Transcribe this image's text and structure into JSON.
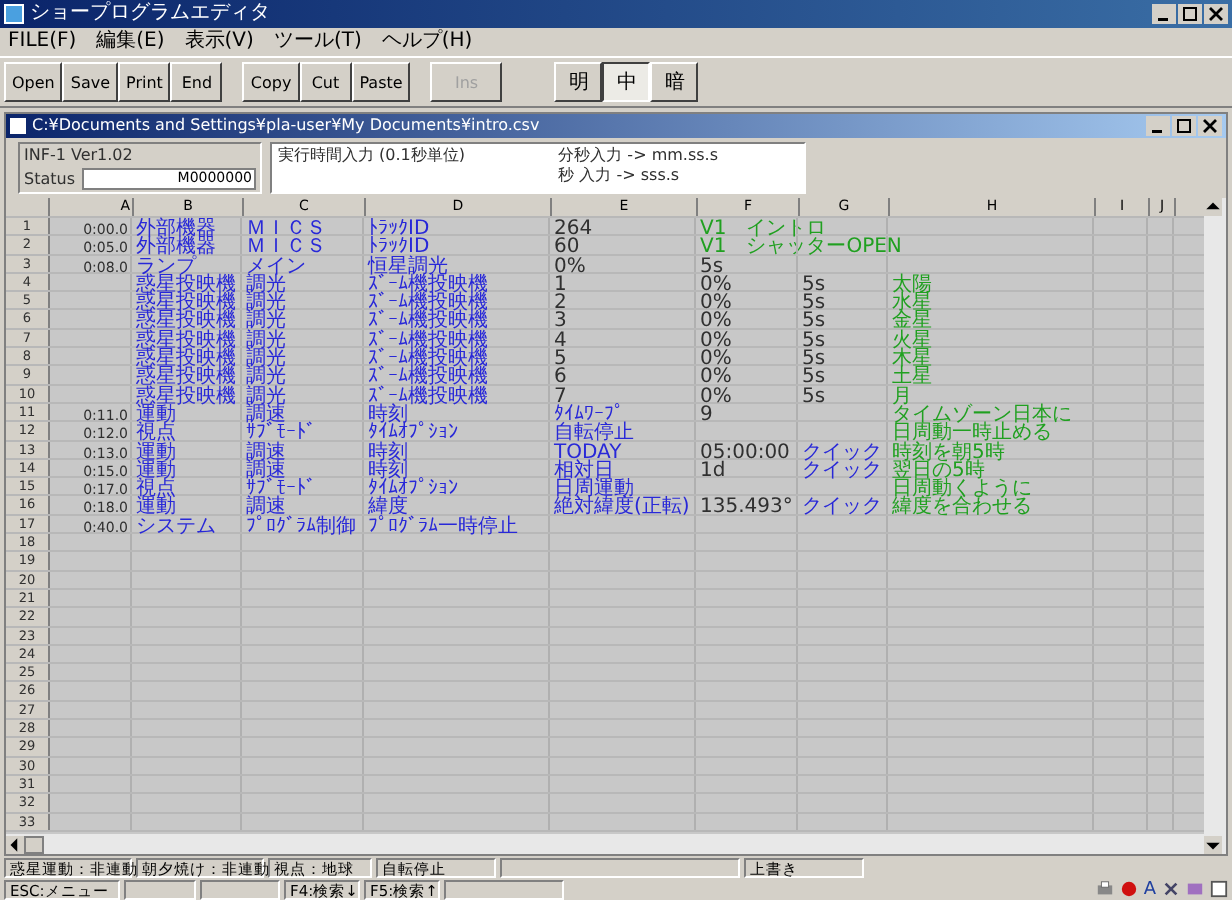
{
  "window": {
    "title": "ショープログラムエディタ"
  },
  "menu": [
    "FILE(F)",
    "編集(E)",
    "表示(V)",
    "ツール(T)",
    "ヘルプ(H)"
  ],
  "toolbar": {
    "groups": [
      [
        {
          "label": "Open",
          "disabled": false
        },
        {
          "label": "Save",
          "disabled": false
        },
        {
          "label": "Print",
          "disabled": false
        },
        {
          "label": "End",
          "disabled": false
        }
      ],
      [
        {
          "label": "Copy",
          "disabled": false
        },
        {
          "label": "Cut",
          "disabled": false
        },
        {
          "label": "Paste",
          "disabled": false
        }
      ],
      [
        {
          "label": "Ins",
          "disabled": true
        }
      ]
    ],
    "modes": [
      {
        "label": "明",
        "selected": false
      },
      {
        "label": "中",
        "selected": true
      },
      {
        "label": "暗",
        "selected": false
      }
    ]
  },
  "document": {
    "title": "C:¥Documents and Settings¥pla-user¥My Documents¥intro.csv"
  },
  "header": {
    "version": "INF-1  Ver1.02",
    "status_label": "Status",
    "status_value": "M0000000",
    "time_label": "実行時間入力 (0.1秒単位)",
    "hint_1": "分秒入力 -> mm.ss.s",
    "hint_2": "秒 入力 -> sss.s"
  },
  "table": {
    "columns": [
      "A",
      "B",
      "C",
      "D",
      "E",
      "F",
      "G",
      "H",
      "I",
      "J"
    ],
    "rows": [
      {
        "number": "1",
        "a": {
          "text": "0:00.0",
          "color": "#303030"
        },
        "b": {
          "text": "外部機器",
          "color": "#2828d8"
        },
        "c": {
          "text": "ＭＩＣＳ",
          "color": "#2828d8"
        },
        "d": {
          "text": "ﾄﾗｯｸID",
          "color": "#2828d8"
        },
        "e": {
          "text": "264",
          "color": "#303030"
        },
        "f": {
          "text": "V1　イントロ",
          "color": "#20a020"
        }
      },
      {
        "number": "2",
        "a": {
          "text": "0:05.0",
          "color": "#303030"
        },
        "b": {
          "text": "外部機器",
          "color": "#2828d8"
        },
        "c": {
          "text": "ＭＩＣＳ",
          "color": "#2828d8"
        },
        "d": {
          "text": "ﾄﾗｯｸID",
          "color": "#2828d8"
        },
        "e": {
          "text": "60",
          "color": "#303030"
        },
        "f": {
          "text": "V1　シャッターOPEN",
          "color": "#20a020"
        }
      },
      {
        "number": "3",
        "a": {
          "text": "0:08.0",
          "color": "#303030"
        },
        "b": {
          "text": "ランプ",
          "color": "#2828d8"
        },
        "c": {
          "text": "メイン",
          "color": "#2828d8"
        },
        "d": {
          "text": "恒星調光",
          "color": "#2828d8"
        },
        "e": {
          "text": "0%",
          "color": "#303030"
        },
        "f": {
          "text": "5s",
          "color": "#303030"
        }
      },
      {
        "number": "4",
        "b": {
          "text": "惑星投映機",
          "color": "#2828d8"
        },
        "c": {
          "text": "調光",
          "color": "#2828d8"
        },
        "d": {
          "text": "ｽﾞｰﾑ機投映機",
          "color": "#2828d8"
        },
        "e": {
          "text": "1",
          "color": "#303030"
        },
        "f": {
          "text": "0%",
          "color": "#303030"
        },
        "g": {
          "text": "5s",
          "color": "#303030"
        },
        "h": {
          "text": "太陽",
          "color": "#20a020"
        }
      },
      {
        "number": "5",
        "b": {
          "text": "惑星投映機",
          "color": "#2828d8"
        },
        "c": {
          "text": "調光",
          "color": "#2828d8"
        },
        "d": {
          "text": "ｽﾞｰﾑ機投映機",
          "color": "#2828d8"
        },
        "e": {
          "text": "2",
          "color": "#303030"
        },
        "f": {
          "text": "0%",
          "color": "#303030"
        },
        "g": {
          "text": "5s",
          "color": "#303030"
        },
        "h": {
          "text": "水星",
          "color": "#20a020"
        }
      },
      {
        "number": "6",
        "b": {
          "text": "惑星投映機",
          "color": "#2828d8"
        },
        "c": {
          "text": "調光",
          "color": "#2828d8"
        },
        "d": {
          "text": "ｽﾞｰﾑ機投映機",
          "color": "#2828d8"
        },
        "e": {
          "text": "3",
          "color": "#303030"
        },
        "f": {
          "text": "0%",
          "color": "#303030"
        },
        "g": {
          "text": "5s",
          "color": "#303030"
        },
        "h": {
          "text": "金星",
          "color": "#20a020"
        }
      },
      {
        "number": "7",
        "b": {
          "text": "惑星投映機",
          "color": "#2828d8"
        },
        "c": {
          "text": "調光",
          "color": "#2828d8"
        },
        "d": {
          "text": "ｽﾞｰﾑ機投映機",
          "color": "#2828d8"
        },
        "e": {
          "text": "4",
          "color": "#303030"
        },
        "f": {
          "text": "0%",
          "color": "#303030"
        },
        "g": {
          "text": "5s",
          "color": "#303030"
        },
        "h": {
          "text": "火星",
          "color": "#20a020"
        }
      },
      {
        "number": "8",
        "b": {
          "text": "惑星投映機",
          "color": "#2828d8"
        },
        "c": {
          "text": "調光",
          "color": "#2828d8"
        },
        "d": {
          "text": "ｽﾞｰﾑ機投映機",
          "color": "#2828d8"
        },
        "e": {
          "text": "5",
          "color": "#303030"
        },
        "f": {
          "text": "0%",
          "color": "#303030"
        },
        "g": {
          "text": "5s",
          "color": "#303030"
        },
        "h": {
          "text": "木星",
          "color": "#20a020"
        }
      },
      {
        "number": "9",
        "b": {
          "text": "惑星投映機",
          "color": "#2828d8"
        },
        "c": {
          "text": "調光",
          "color": "#2828d8"
        },
        "d": {
          "text": "ｽﾞｰﾑ機投映機",
          "color": "#2828d8"
        },
        "e": {
          "text": "6",
          "color": "#303030"
        },
        "f": {
          "text": "0%",
          "color": "#303030"
        },
        "g": {
          "text": "5s",
          "color": "#303030"
        },
        "h": {
          "text": "土星",
          "color": "#20a020"
        }
      },
      {
        "number": "10",
        "b": {
          "text": "惑星投映機",
          "color": "#2828d8"
        },
        "c": {
          "text": "調光",
          "color": "#2828d8"
        },
        "d": {
          "text": "ｽﾞｰﾑ機投映機",
          "color": "#2828d8"
        },
        "e": {
          "text": "7",
          "color": "#303030"
        },
        "f": {
          "text": "0%",
          "color": "#303030"
        },
        "g": {
          "text": "5s",
          "color": "#303030"
        },
        "h": {
          "text": "月",
          "color": "#20a020"
        }
      },
      {
        "number": "11",
        "a": {
          "text": "0:11.0",
          "color": "#303030"
        },
        "b": {
          "text": "運動",
          "color": "#2828d8"
        },
        "c": {
          "text": "調速",
          "color": "#2828d8"
        },
        "d": {
          "text": "時刻",
          "color": "#2828d8"
        },
        "e": {
          "text": "ﾀｲﾑﾜｰﾌﾟ",
          "color": "#2828d8"
        },
        "f": {
          "text": "9",
          "color": "#303030"
        },
        "h": {
          "text": "タイムゾーン日本に",
          "color": "#20a020"
        }
      },
      {
        "number": "12",
        "a": {
          "text": "0:12.0",
          "color": "#303030"
        },
        "b": {
          "text": "視点",
          "color": "#2828d8"
        },
        "c": {
          "text": "ｻﾌﾞﾓｰﾄﾞ",
          "color": "#2828d8"
        },
        "d": {
          "text": "ﾀｲﾑｵﾌﾟｼｮﾝ",
          "color": "#2828d8"
        },
        "e": {
          "text": "自転停止",
          "color": "#2828d8"
        },
        "h": {
          "text": "日周動一時止める",
          "color": "#20a020"
        }
      },
      {
        "number": "13",
        "a": {
          "text": "0:13.0",
          "color": "#303030"
        },
        "b": {
          "text": "運動",
          "color": "#2828d8"
        },
        "c": {
          "text": "調速",
          "color": "#2828d8"
        },
        "d": {
          "text": "時刻",
          "color": "#2828d8"
        },
        "e": {
          "text": "TODAY",
          "color": "#2828d8"
        },
        "f": {
          "text": "05:00:00",
          "color": "#303030"
        },
        "g": {
          "text": "クイック",
          "color": "#2828d8"
        },
        "h": {
          "text": "時刻を朝5時",
          "color": "#20a020"
        }
      },
      {
        "number": "14",
        "a": {
          "text": "0:15.0",
          "color": "#303030"
        },
        "b": {
          "text": "運動",
          "color": "#2828d8"
        },
        "c": {
          "text": "調速",
          "color": "#2828d8"
        },
        "d": {
          "text": "時刻",
          "color": "#2828d8"
        },
        "e": {
          "text": "相対日",
          "color": "#2828d8"
        },
        "f": {
          "text": "1d",
          "color": "#303030"
        },
        "g": {
          "text": "クイック",
          "color": "#2828d8"
        },
        "h": {
          "text": "翌日の5時",
          "color": "#20a020"
        }
      },
      {
        "number": "15",
        "a": {
          "text": "0:17.0",
          "color": "#303030"
        },
        "b": {
          "text": "視点",
          "color": "#2828d8"
        },
        "c": {
          "text": "ｻﾌﾞﾓｰﾄﾞ",
          "color": "#2828d8"
        },
        "d": {
          "text": "ﾀｲﾑｵﾌﾟｼｮﾝ",
          "color": "#2828d8"
        },
        "e": {
          "text": "日周運動",
          "color": "#2828d8"
        },
        "h": {
          "text": "日周動くように",
          "color": "#20a020"
        }
      },
      {
        "number": "16",
        "a": {
          "text": "0:18.0",
          "color": "#303030"
        },
        "b": {
          "text": "運動",
          "color": "#2828d8"
        },
        "c": {
          "text": "調速",
          "color": "#2828d8"
        },
        "d": {
          "text": "緯度",
          "color": "#2828d8"
        },
        "e": {
          "text": "絶対緯度(正転)",
          "color": "#2828d8"
        },
        "f": {
          "text": "135.493°",
          "color": "#303030"
        },
        "g": {
          "text": "クイック",
          "color": "#2828d8"
        },
        "h": {
          "text": "緯度を合わせる",
          "color": "#20a020"
        }
      },
      {
        "number": "17",
        "a": {
          "text": "0:40.0",
          "color": "#303030"
        },
        "b": {
          "text": "システム",
          "color": "#2828d8"
        },
        "c": {
          "text": "ﾌﾟﾛｸﾞﾗﾑ制御",
          "color": "#2828d8"
        },
        "d": {
          "text": "ﾌﾟﾛｸﾞﾗﾑ一時停止",
          "color": "#2828d8"
        }
      },
      {
        "number": "18"
      },
      {
        "number": "19"
      },
      {
        "number": "20"
      },
      {
        "number": "21"
      },
      {
        "number": "22"
      },
      {
        "number": "23"
      },
      {
        "number": "24"
      },
      {
        "number": "25"
      },
      {
        "number": "26"
      },
      {
        "number": "27"
      },
      {
        "number": "28"
      },
      {
        "number": "29"
      },
      {
        "number": "30"
      },
      {
        "number": "31"
      },
      {
        "number": "32"
      },
      {
        "number": "33"
      }
    ]
  },
  "status_bar": {
    "row_1": [
      "惑星運動：非連動",
      "朝夕焼け：非連動",
      "視点：地球",
      "自転停止",
      "上書き"
    ],
    "row_2": [
      "ESC:メニュー",
      "F4:検索↓",
      "F5:検索↑"
    ],
    "tray_label": "A"
  }
}
